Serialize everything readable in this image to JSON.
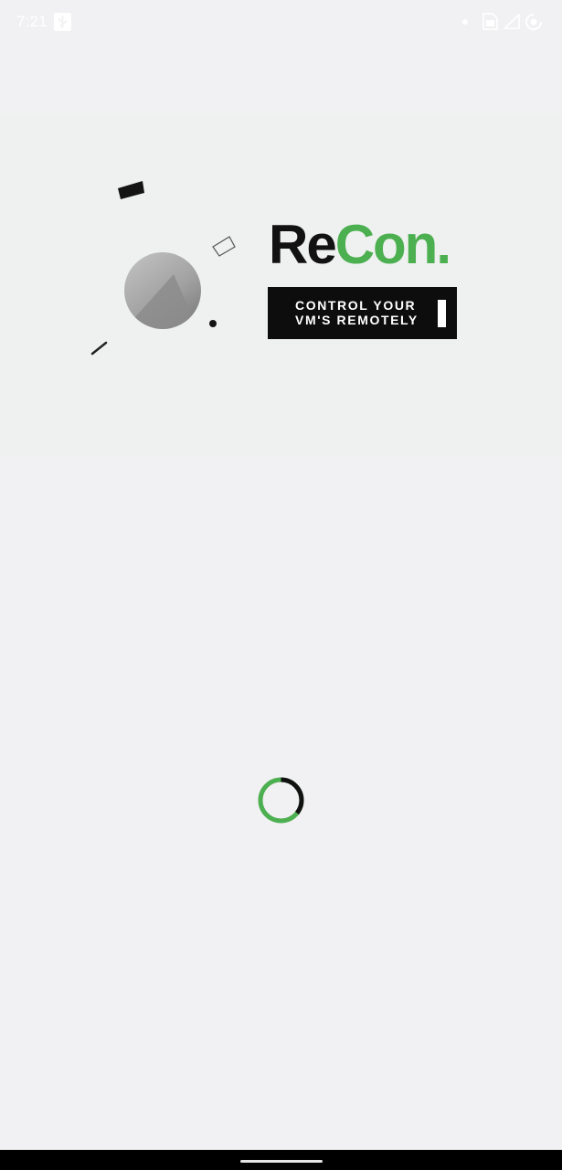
{
  "status_bar": {
    "time": "7:21",
    "icons": [
      "usb-icon",
      "notification-dot-icon",
      "sim-card-icon",
      "signal-icon",
      "battery-icon"
    ]
  },
  "splash": {
    "logo": {
      "part1": "Re",
      "part2": "Con",
      "part3": ".",
      "colors": {
        "dark": "#121212",
        "accent": "#4caf50"
      }
    },
    "tagline": {
      "line1": "CONTROL YOUR",
      "line2": "VM'S REMOTELY"
    },
    "illustration": [
      "sphere-graphic",
      "shape-fragments"
    ]
  },
  "loading": {
    "indicator": "spinner-icon",
    "colors": {
      "track": "#4caf50",
      "arc": "#111111"
    }
  },
  "navigation": {
    "gesture": "home-pill"
  }
}
